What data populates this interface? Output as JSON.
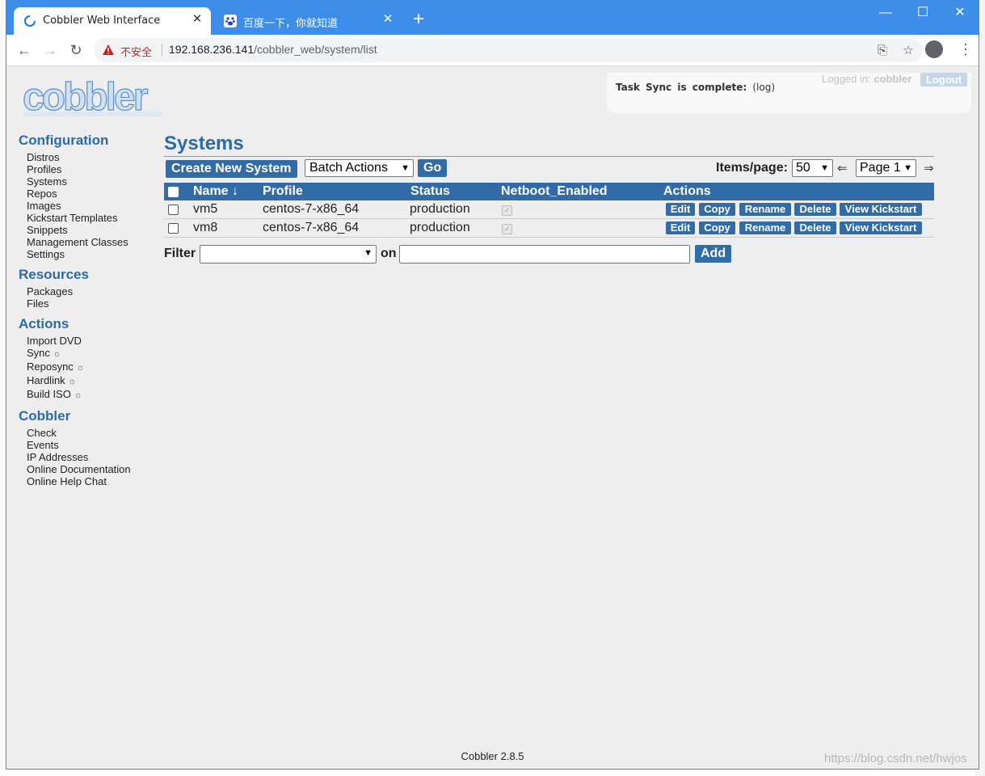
{
  "browser": {
    "tabs": [
      {
        "title": "Cobbler Web Interface",
        "active": true
      },
      {
        "title": "百度一下，你就知道",
        "active": false
      }
    ],
    "insecure_label": "不安全",
    "url_host": "192.168.236.141",
    "url_path": "/cobbler_web/system/list"
  },
  "header": {
    "logo_text": "cobbler",
    "task_message": "Task Sync is complete:",
    "task_link": "(log)",
    "logged_in_label": "Logged in:",
    "username": "cobbler",
    "logout_label": "Logout"
  },
  "sidebar": {
    "sections": [
      {
        "title": "Configuration",
        "items": [
          "Distros",
          "Profiles",
          "Systems",
          "Repos",
          "Images",
          "Kickstart Templates",
          "Snippets",
          "Management Classes",
          "Settings"
        ]
      },
      {
        "title": "Resources",
        "items": [
          "Packages",
          "Files"
        ]
      },
      {
        "title": "Actions",
        "items": [
          "Import DVD",
          "Sync",
          "Reposync",
          "Hardlink",
          "Build ISO"
        ]
      },
      {
        "title": "Cobbler",
        "items": [
          "Check",
          "Events",
          "IP Addresses",
          "Online Documentation",
          "Online Help Chat"
        ]
      }
    ]
  },
  "main": {
    "title": "Systems",
    "create_button": "Create New System",
    "batch_select": "Batch Actions",
    "go_button": "Go",
    "items_per_page_label": "Items/page:",
    "items_per_page": "50",
    "prev_arrow": "⇐",
    "page_select": "Page 1",
    "next_arrow": "⇒",
    "columns": [
      "Name ↓",
      "Profile",
      "Status",
      "Netboot_Enabled",
      "Actions"
    ],
    "rows": [
      {
        "name": "vm5",
        "profile": "centos-7-x86_64",
        "status": "production",
        "netboot": true
      },
      {
        "name": "vm8",
        "profile": "centos-7-x86_64",
        "status": "production",
        "netboot": true
      }
    ],
    "row_actions": [
      "Edit",
      "Copy",
      "Rename",
      "Delete",
      "View Kickstart"
    ],
    "filter_label": "Filter",
    "filter_on": "on",
    "filter_value": "",
    "add_button": "Add"
  },
  "footer": {
    "version": "Cobbler 2.8.5"
  },
  "watermark": "https://blog.csdn.net/hwjos",
  "colors": {
    "titlebar": "#3e8ee9",
    "accent": "#316ba8",
    "heading": "#2d6aa8",
    "page_bg": "#eeeeee"
  }
}
